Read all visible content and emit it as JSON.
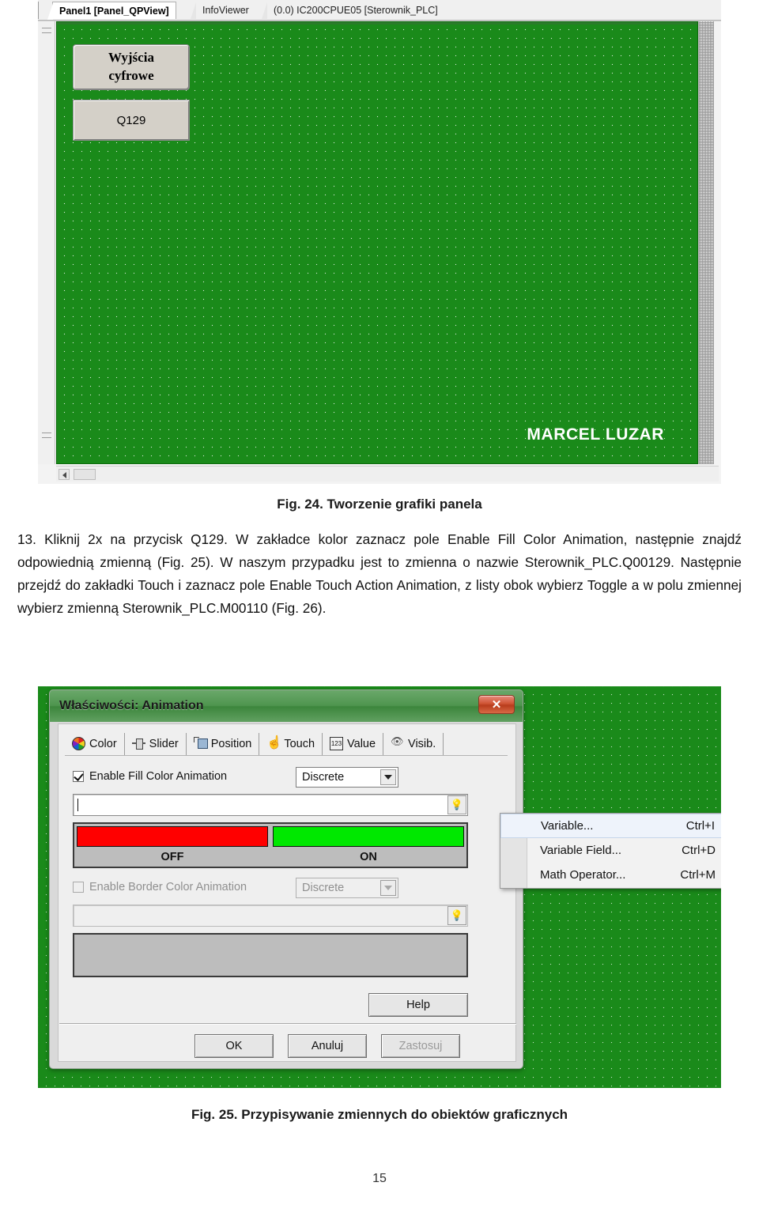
{
  "figure24": {
    "tabs": [
      {
        "label": "Panel1 [Panel_QPView]",
        "active": true
      },
      {
        "label": "InfoViewer",
        "active": false
      },
      {
        "label": "(0.0) IC200CPUE05 [Sterownik_PLC]",
        "active": false
      }
    ],
    "canvas": {
      "objects": [
        {
          "type": "label",
          "text": "Wyjścia cyfrowe",
          "line1": "Wyjścia",
          "line2": "cyfrowe"
        },
        {
          "type": "button",
          "text": "Q129"
        }
      ],
      "watermark": "MARCEL LUZAR",
      "background_color": "#1a8a1a"
    }
  },
  "caption24": "Fig. 24. Tworzenie grafiki panela",
  "body": {
    "step_number": "13.",
    "paragraph": "13. Kliknij 2x na przycisk Q129. W zakładce kolor zaznacz pole Enable Fill Color Animation, następnie znajdź odpowiednią zmienną (Fig. 25). W naszym przypadku jest to zmienna o nazwie Sterownik_PLC.Q00129. Następnie przejdź do zakładki Touch i zaznacz pole Enable Touch  Action Animation, z listy obok wybierz Toggle a w polu zmiennej wybierz zmienną Sterownik_PLC.M00110 (Fig. 26)."
  },
  "figure25": {
    "dialog": {
      "title": "Właściwości: Animation",
      "close_label": "✕",
      "tabs": [
        {
          "label": "Color",
          "icon": "color-wheel-icon",
          "selected": true
        },
        {
          "label": "Slider",
          "icon": "slider-icon",
          "selected": false
        },
        {
          "label": "Position",
          "icon": "position-icon",
          "selected": false
        },
        {
          "label": "Touch",
          "icon": "hand-pointer-icon",
          "selected": false
        },
        {
          "label": "Value",
          "icon": "numeric-123-icon",
          "selected": false
        },
        {
          "label": "Visib.",
          "icon": "eye-icon",
          "selected": false
        }
      ],
      "fill_section": {
        "checkbox_label": "Enable Fill Color Animation",
        "checked": true,
        "mode": "Discrete",
        "expression_value": "",
        "bulb_icon": "lightbulb-icon",
        "states": [
          {
            "label": "OFF",
            "color": "#ff0000"
          },
          {
            "label": "ON",
            "color": "#00e800"
          }
        ]
      },
      "border_section": {
        "checkbox_label": "Enable Border Color Animation",
        "checked": false,
        "enabled": false,
        "mode": "Discrete",
        "expression_value": "",
        "bulb_icon": "lightbulb-icon"
      },
      "buttons": {
        "help": "Help",
        "ok": "OK",
        "cancel": "Anuluj",
        "apply": "Zastosuj",
        "apply_disabled": true
      }
    },
    "context_menu": {
      "items": [
        {
          "label": "Variable...",
          "shortcut": "Ctrl+I",
          "highlighted": true
        },
        {
          "label": "Variable Field...",
          "shortcut": "Ctrl+D",
          "highlighted": false
        },
        {
          "label": "Math Operator...",
          "shortcut": "Ctrl+M",
          "highlighted": false
        }
      ]
    }
  },
  "caption25": "Fig. 25. Przypisywanie zmiennych do obiektów graficznych",
  "page_number": "15"
}
